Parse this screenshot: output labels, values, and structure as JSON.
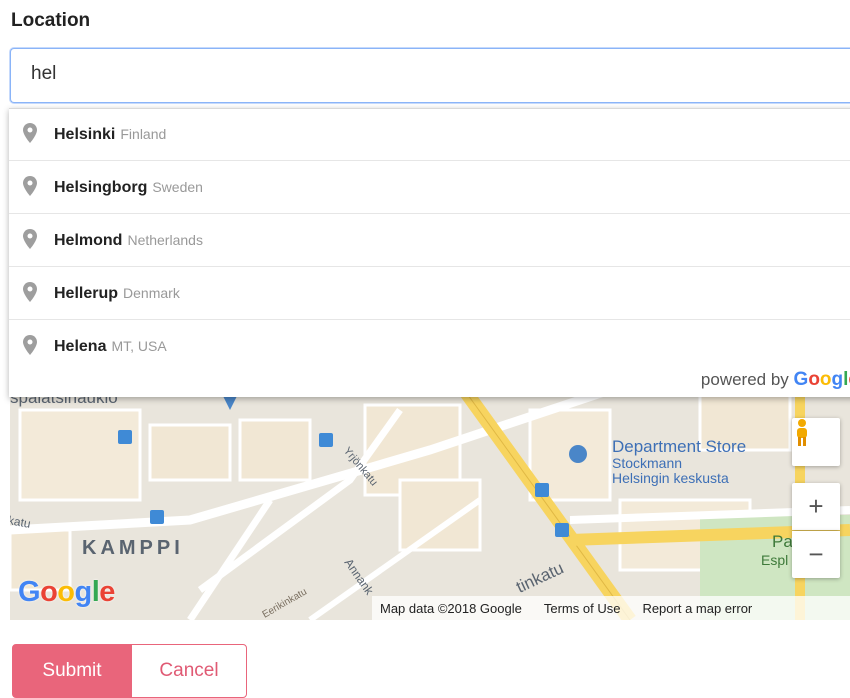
{
  "form": {
    "location_label": "Location",
    "location_value": "hel"
  },
  "suggestions": [
    {
      "match": "Hel",
      "rest": "sinki",
      "secondary": "Finland"
    },
    {
      "match": "Hel",
      "rest": "singborg",
      "secondary": "Sweden"
    },
    {
      "match": "Hel",
      "rest": "mond",
      "secondary": "Netherlands"
    },
    {
      "match": "Hel",
      "rest": "lerup",
      "secondary": "Denmark"
    },
    {
      "match": "Hel",
      "rest": "ena",
      "secondary": "MT, USA"
    }
  ],
  "powered_by": {
    "text": "powered by",
    "logo_letters": [
      "G",
      "o",
      "o",
      "g",
      "l",
      "e"
    ],
    "logo_colors": [
      "#4285f4",
      "#ea4335",
      "#fbbc05",
      "#4285f4",
      "#34a853",
      "#ea4335"
    ]
  },
  "map": {
    "labels": {
      "spalatsi": "spalatsinaukio",
      "kamppi": "KAMPPI",
      "store_title": "Department Store",
      "store_line2": "Stockmann",
      "store_line3": "Helsingin keskusta",
      "yrjon": "Yrjönkatu",
      "eerikin": "Eerikinkatu",
      "annan": "Annank",
      "tinkatu": "tinkatu",
      "katu": "katu",
      "pa": "Pa",
      "espl": "Espl"
    },
    "google_mark": "Google",
    "attribution": {
      "map_data": "Map data ©2018 Google",
      "terms": "Terms of Use",
      "report": "Report a map error"
    },
    "zoom_in": "+",
    "zoom_out": "−"
  },
  "actions": {
    "submit": "Submit",
    "cancel": "Cancel"
  },
  "colors": {
    "accent": "#e9657b",
    "focus_border": "#8ab4f8",
    "map_road_yellow": "#f7d45f",
    "map_store_blue": "#3d6fb6"
  }
}
